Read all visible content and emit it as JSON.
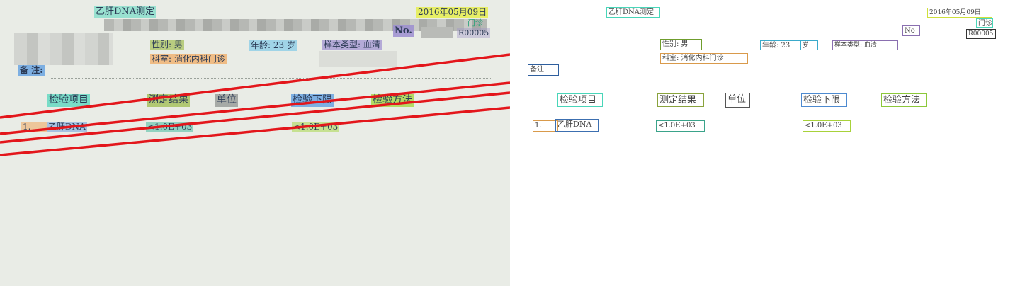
{
  "doc": {
    "title": "乙肝DNA测定",
    "date": "2016年05月09日",
    "dept_type": "门诊",
    "no_label": "No.",
    "no_value": "R00005",
    "gender": "性别: 男",
    "age": "年龄: 23 岁",
    "sample_type": "样本类型: 血清",
    "department": "科室: 消化内科门诊",
    "remark_label": "备 注:",
    "headers": [
      "检验项目",
      "测定结果",
      "单位",
      "检验下限",
      "检验方法"
    ],
    "row": {
      "index": "1.",
      "item": "乙肝DNA",
      "result": "<1.0E+03",
      "lower": "<1.0E+03"
    }
  },
  "annot": {
    "title": "乙肝DNA测定",
    "date": "2016年05月09日",
    "dept_type": "门诊",
    "no_label": "No",
    "no_value": "R00005",
    "gender": "性别: 男",
    "age": "年龄: 23",
    "age_unit": "岁",
    "sample_type": "样本类型: 血清",
    "department": "科室: 消化内科门诊",
    "remark": "备注",
    "headers": [
      "检验项目",
      "测定结果",
      "单位",
      "检验下限",
      "检验方法"
    ],
    "row_index": "1.",
    "row_item": "乙肝DNA",
    "row_result": "<1.0E+03",
    "row_lower": "<1.0E+03"
  },
  "colors": {
    "paper": "#e9ece6",
    "red_strike": "#e3161b",
    "hl_cyan": "#49d6b9",
    "hl_yellow": "#e7ee57",
    "hl_olive": "#a7c25e",
    "hl_purple": "#9c8ed0",
    "hl_orange": "#f1a85b",
    "hl_blue": "#6aa5e0",
    "hl_gray": "#9ea39e",
    "hl_lightblue": "#6fc4e8",
    "hl_green": "#a9d84b"
  }
}
